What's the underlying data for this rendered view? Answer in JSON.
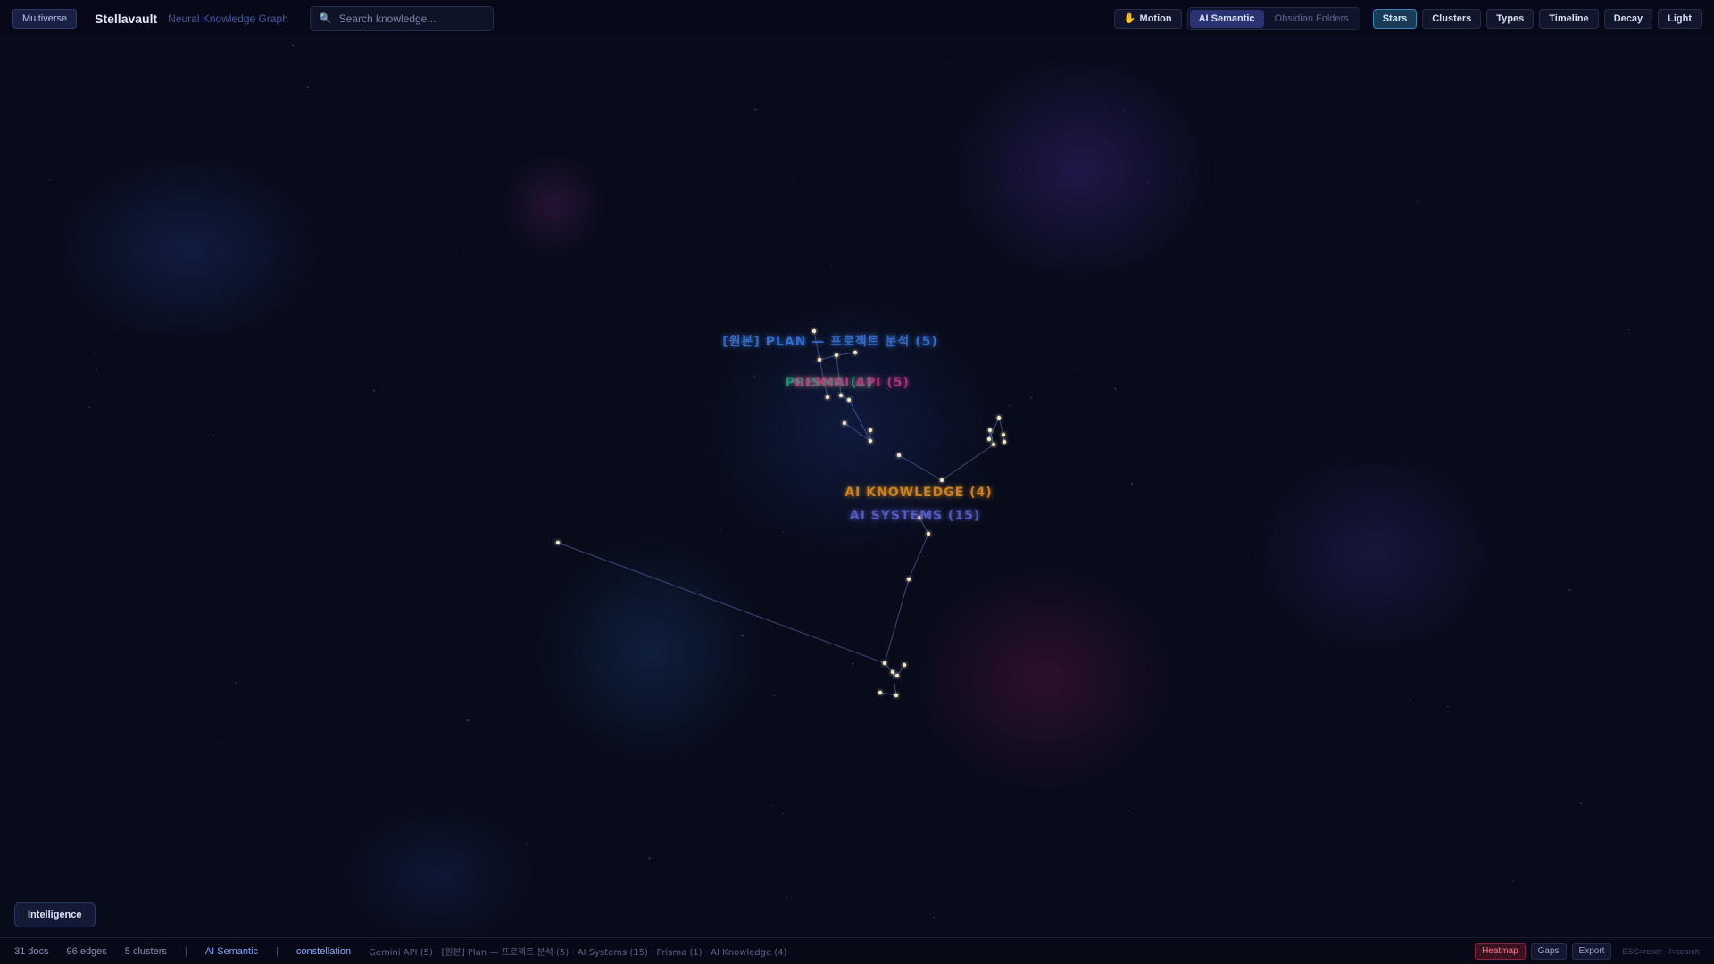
{
  "header": {
    "multiverse_label": "Multiverse",
    "brand": "Stellavault",
    "tagline": "Neural Knowledge Graph",
    "search_placeholder": "Search knowledge...",
    "motion_label": "Motion",
    "mode_tabs": [
      {
        "label": "AI Semantic",
        "active": true
      },
      {
        "label": "Obsidian Folders",
        "active": false
      }
    ],
    "view_buttons": [
      {
        "label": "Stars",
        "active": true
      },
      {
        "label": "Clusters",
        "active": false
      },
      {
        "label": "Types",
        "active": false
      },
      {
        "label": "Timeline",
        "active": false
      },
      {
        "label": "Decay",
        "active": false
      },
      {
        "label": "Light",
        "active": false
      }
    ]
  },
  "clusters": [
    {
      "label": "[원본] PLAN — 프로젝트 분석 (5)",
      "color": "#3a74d6"
    },
    {
      "label": "PRISMA (1)",
      "color": "#22a07a"
    },
    {
      "label": "GEMINI API (5)",
      "color": "#c23a82"
    },
    {
      "label": "AI KNOWLEDGE (4)",
      "color": "#d98a1e"
    },
    {
      "label": "AI SYSTEMS (15)",
      "color": "#5a5fc9"
    }
  ],
  "intelligence_label": "Intelligence",
  "status": {
    "docs": "31 docs",
    "edges": "96 edges",
    "clusters": "5 clusters",
    "separator": "|",
    "mode": "AI Semantic",
    "view": "constellation",
    "summary": "Gemini API (5) · [원본] Plan — 프로젝트 분석 (5) · AI Systems (15) · Prisma (1) · AI Knowledge (4)",
    "heatmap": "Heatmap",
    "gaps": "Gaps",
    "export": "Export",
    "hint": "ESC=reset · /=search"
  },
  "colors": {
    "background": "#080b1a",
    "star": "#f3e6c4",
    "edge": "#6a78c8",
    "accent": "#2a3372"
  }
}
